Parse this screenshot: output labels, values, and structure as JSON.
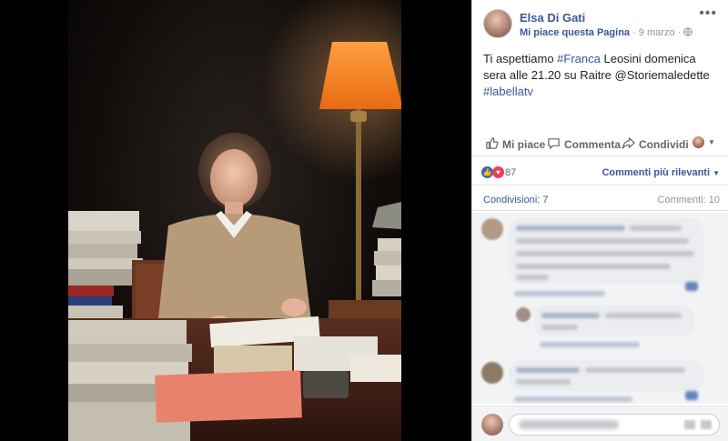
{
  "page": {
    "name": "Elsa Di Gati",
    "like_page_label": "Mi piace questa Pagina",
    "separator": "·",
    "date": "9 marzo",
    "privacy_icon": "globe-icon",
    "more_icon": "more-options-icon"
  },
  "post": {
    "text_prefix": "Ti aspettiamo ",
    "tag_franca": "#Franca",
    "text_middle": " Leosini domenica sera alle 21.20 su Raitre @Storiemaledette ",
    "tag_labellatv": "#labellatv"
  },
  "actions": {
    "like": "Mi piace",
    "comment": "Commenta",
    "share": "Condividi"
  },
  "reactions": {
    "count": "87",
    "sort_label": "Commenti più rilevanti"
  },
  "stats": {
    "shares": "Condivisioni: 7",
    "comments": "Commenti: 10"
  },
  "colors": {
    "link_blue": "#385898",
    "like_blue": "#4267b2",
    "love_red": "#f33e58",
    "lamp_orange": "#ff8a2a"
  }
}
